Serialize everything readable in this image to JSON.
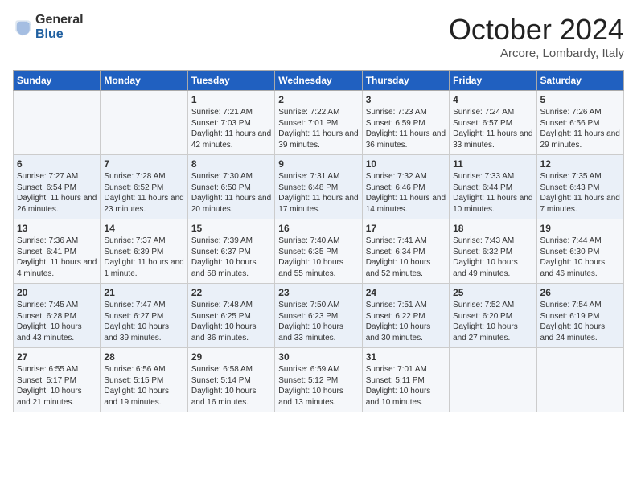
{
  "header": {
    "logo_general": "General",
    "logo_blue": "Blue",
    "month_title": "October 2024",
    "subtitle": "Arcore, Lombardy, Italy"
  },
  "columns": [
    "Sunday",
    "Monday",
    "Tuesday",
    "Wednesday",
    "Thursday",
    "Friday",
    "Saturday"
  ],
  "weeks": [
    [
      {
        "day": "",
        "info": ""
      },
      {
        "day": "",
        "info": ""
      },
      {
        "day": "1",
        "info": "Sunrise: 7:21 AM\nSunset: 7:03 PM\nDaylight: 11 hours and 42 minutes."
      },
      {
        "day": "2",
        "info": "Sunrise: 7:22 AM\nSunset: 7:01 PM\nDaylight: 11 hours and 39 minutes."
      },
      {
        "day": "3",
        "info": "Sunrise: 7:23 AM\nSunset: 6:59 PM\nDaylight: 11 hours and 36 minutes."
      },
      {
        "day": "4",
        "info": "Sunrise: 7:24 AM\nSunset: 6:57 PM\nDaylight: 11 hours and 33 minutes."
      },
      {
        "day": "5",
        "info": "Sunrise: 7:26 AM\nSunset: 6:56 PM\nDaylight: 11 hours and 29 minutes."
      }
    ],
    [
      {
        "day": "6",
        "info": "Sunrise: 7:27 AM\nSunset: 6:54 PM\nDaylight: 11 hours and 26 minutes."
      },
      {
        "day": "7",
        "info": "Sunrise: 7:28 AM\nSunset: 6:52 PM\nDaylight: 11 hours and 23 minutes."
      },
      {
        "day": "8",
        "info": "Sunrise: 7:30 AM\nSunset: 6:50 PM\nDaylight: 11 hours and 20 minutes."
      },
      {
        "day": "9",
        "info": "Sunrise: 7:31 AM\nSunset: 6:48 PM\nDaylight: 11 hours and 17 minutes."
      },
      {
        "day": "10",
        "info": "Sunrise: 7:32 AM\nSunset: 6:46 PM\nDaylight: 11 hours and 14 minutes."
      },
      {
        "day": "11",
        "info": "Sunrise: 7:33 AM\nSunset: 6:44 PM\nDaylight: 11 hours and 10 minutes."
      },
      {
        "day": "12",
        "info": "Sunrise: 7:35 AM\nSunset: 6:43 PM\nDaylight: 11 hours and 7 minutes."
      }
    ],
    [
      {
        "day": "13",
        "info": "Sunrise: 7:36 AM\nSunset: 6:41 PM\nDaylight: 11 hours and 4 minutes."
      },
      {
        "day": "14",
        "info": "Sunrise: 7:37 AM\nSunset: 6:39 PM\nDaylight: 11 hours and 1 minute."
      },
      {
        "day": "15",
        "info": "Sunrise: 7:39 AM\nSunset: 6:37 PM\nDaylight: 10 hours and 58 minutes."
      },
      {
        "day": "16",
        "info": "Sunrise: 7:40 AM\nSunset: 6:35 PM\nDaylight: 10 hours and 55 minutes."
      },
      {
        "day": "17",
        "info": "Sunrise: 7:41 AM\nSunset: 6:34 PM\nDaylight: 10 hours and 52 minutes."
      },
      {
        "day": "18",
        "info": "Sunrise: 7:43 AM\nSunset: 6:32 PM\nDaylight: 10 hours and 49 minutes."
      },
      {
        "day": "19",
        "info": "Sunrise: 7:44 AM\nSunset: 6:30 PM\nDaylight: 10 hours and 46 minutes."
      }
    ],
    [
      {
        "day": "20",
        "info": "Sunrise: 7:45 AM\nSunset: 6:28 PM\nDaylight: 10 hours and 43 minutes."
      },
      {
        "day": "21",
        "info": "Sunrise: 7:47 AM\nSunset: 6:27 PM\nDaylight: 10 hours and 39 minutes."
      },
      {
        "day": "22",
        "info": "Sunrise: 7:48 AM\nSunset: 6:25 PM\nDaylight: 10 hours and 36 minutes."
      },
      {
        "day": "23",
        "info": "Sunrise: 7:50 AM\nSunset: 6:23 PM\nDaylight: 10 hours and 33 minutes."
      },
      {
        "day": "24",
        "info": "Sunrise: 7:51 AM\nSunset: 6:22 PM\nDaylight: 10 hours and 30 minutes."
      },
      {
        "day": "25",
        "info": "Sunrise: 7:52 AM\nSunset: 6:20 PM\nDaylight: 10 hours and 27 minutes."
      },
      {
        "day": "26",
        "info": "Sunrise: 7:54 AM\nSunset: 6:19 PM\nDaylight: 10 hours and 24 minutes."
      }
    ],
    [
      {
        "day": "27",
        "info": "Sunrise: 6:55 AM\nSunset: 5:17 PM\nDaylight: 10 hours and 21 minutes."
      },
      {
        "day": "28",
        "info": "Sunrise: 6:56 AM\nSunset: 5:15 PM\nDaylight: 10 hours and 19 minutes."
      },
      {
        "day": "29",
        "info": "Sunrise: 6:58 AM\nSunset: 5:14 PM\nDaylight: 10 hours and 16 minutes."
      },
      {
        "day": "30",
        "info": "Sunrise: 6:59 AM\nSunset: 5:12 PM\nDaylight: 10 hours and 13 minutes."
      },
      {
        "day": "31",
        "info": "Sunrise: 7:01 AM\nSunset: 5:11 PM\nDaylight: 10 hours and 10 minutes."
      },
      {
        "day": "",
        "info": ""
      },
      {
        "day": "",
        "info": ""
      }
    ]
  ]
}
